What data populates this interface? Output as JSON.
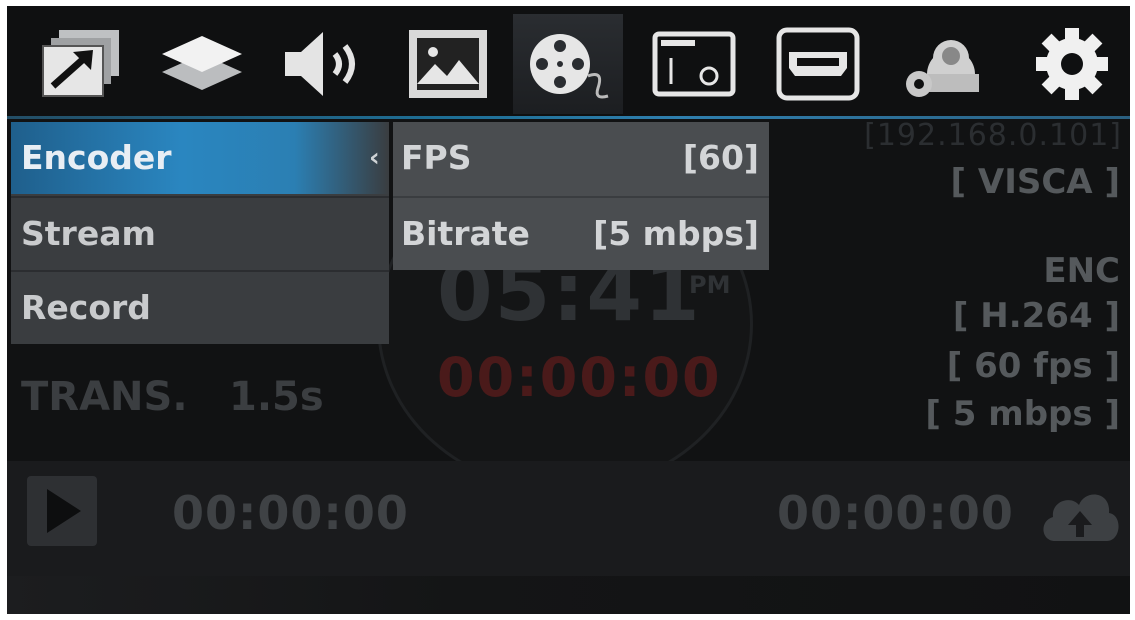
{
  "toolbar": {
    "icons": [
      "transition-icon",
      "layers-icon",
      "speaker-icon",
      "image-icon",
      "film-reel-icon",
      "capture-card-icon",
      "hdmi-icon",
      "ptz-camera-icon",
      "gear-icon"
    ],
    "active_index": 4
  },
  "menu": {
    "items": [
      {
        "label": "Encoder",
        "selected": true
      },
      {
        "label": "Stream"
      },
      {
        "label": "Record"
      }
    ],
    "submenu": [
      {
        "label": "FPS",
        "value": "[60]"
      },
      {
        "label": "Bitrate",
        "value": "[5 mbps]"
      }
    ]
  },
  "status": {
    "ip": "[192.168.0.101]",
    "protocol": "[ VISCA ]",
    "enc_label": "ENC",
    "codec": "[ H.264 ]",
    "fps": "[ 60 fps ]",
    "bitrate": "[ 5 mbps ]"
  },
  "clock": {
    "time": "05:41",
    "ampm": "PM",
    "record_time": "00:00:00"
  },
  "transition": {
    "label": "TRANS.",
    "value": "1.5s"
  },
  "bottom": {
    "time_left": "00:00:00",
    "time_right": "00:00:00"
  },
  "colors": {
    "accent": "#2a86c0",
    "background": "#111213",
    "menu_bg": "#3a3d40",
    "submenu_bg": "#4a4d50"
  }
}
